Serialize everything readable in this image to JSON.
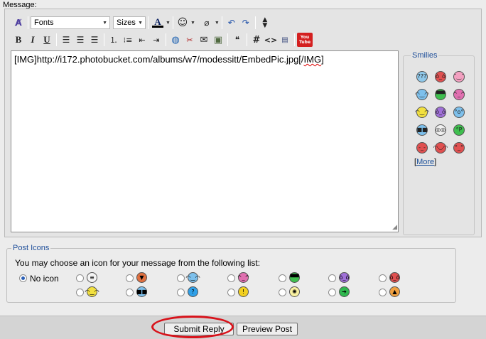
{
  "message_label": "Message:",
  "toolbar": {
    "fonts_select": "Fonts",
    "sizes_select": "Sizes",
    "bold": "B",
    "italic": "I",
    "underline": "U",
    "hash": "#",
    "code": "<>",
    "youtube": "You Tube",
    "icons": [
      "remove-format-icon",
      "font-color-icon",
      "smilie-icon",
      "attach-icon",
      "undo-icon",
      "redo-icon",
      "resize-icon",
      "align-left-icon",
      "align-center-icon",
      "align-right-icon",
      "ordered-list-icon",
      "unordered-list-icon",
      "outdent-icon",
      "indent-icon",
      "link-icon",
      "unlink-icon",
      "email-icon",
      "image-icon",
      "quote-icon",
      "php-icon"
    ]
  },
  "editor": {
    "content_before": "[IMG]http://i172.photobucket.com/albums/w7/modessitt/EmbedPic.jpg[/",
    "content_misspelled": "IMG",
    "content_after": "]"
  },
  "smilies": {
    "legend": "Smilies",
    "more_open": "[",
    "more_link": "More",
    "more_close": "]",
    "items": [
      {
        "glyph": "???",
        "color": "#8fc8ea"
      },
      {
        "glyph": "ò_ó",
        "color": "#e05050"
      },
      {
        "glyph": "˘‿˘",
        "color": "#f2a0c0"
      },
      {
        "glyph": "◠‿◠",
        "color": "#7dc0ec"
      },
      {
        "glyph": "▀▀",
        "color": "#3fbf4f"
      },
      {
        "glyph": "^_^",
        "color": "#e070b0"
      },
      {
        "glyph": "◠‿◠",
        "color": "#f2e040"
      },
      {
        "glyph": "ò_ó",
        "color": "#a070d8"
      },
      {
        "glyph": "°o°",
        "color": "#7dc0ec"
      },
      {
        "glyph": "■■",
        "color": "#7dc0ec"
      },
      {
        "glyph": "◎◎",
        "color": "#f0f0f0"
      },
      {
        "glyph": "°P",
        "color": "#3fbf4f"
      },
      {
        "glyph": "-_-",
        "color": "#e05050"
      },
      {
        "glyph": "◠◡◠",
        "color": "#e05050"
      },
      {
        "glyph": "°_°",
        "color": "#e05050"
      }
    ]
  },
  "post_icons": {
    "legend": "Post Icons",
    "instruction": "You may choose an icon for your message from the following list:",
    "no_icon_label": "No icon",
    "icons": [
      {
        "name": "post-icon-document",
        "glyph": "≡",
        "color": "#f4f4f4"
      },
      {
        "name": "post-icon-thumbs-down",
        "glyph": "▼",
        "color": "#e07040"
      },
      {
        "name": "post-icon-smile-blue",
        "glyph": "◠‿◠",
        "color": "#7dc0ec"
      },
      {
        "name": "post-icon-smile-pink",
        "glyph": "^_^",
        "color": "#e070b0"
      },
      {
        "name": "post-icon-grin-green",
        "glyph": "▀▀",
        "color": "#3fbf4f"
      },
      {
        "name": "post-icon-sad-purple",
        "glyph": "ò_ó",
        "color": "#a070d8"
      },
      {
        "name": "post-icon-angry-red",
        "glyph": "ò_ó",
        "color": "#e05050"
      },
      {
        "name": "post-icon-smile-yellow",
        "glyph": "◠‿◠",
        "color": "#f2e040"
      },
      {
        "name": "post-icon-cool",
        "glyph": "■■",
        "color": "#7dc0ec"
      },
      {
        "name": "post-icon-question",
        "glyph": "?",
        "color": "#2fa0e8"
      },
      {
        "name": "post-icon-warning",
        "glyph": "!",
        "color": "#f2d020"
      },
      {
        "name": "post-icon-lightbulb",
        "glyph": "✺",
        "color": "#f8f0a0"
      },
      {
        "name": "post-icon-arrow",
        "glyph": "➔",
        "color": "#2fb84f"
      },
      {
        "name": "post-icon-thumbs-up",
        "glyph": "▲",
        "color": "#f0a040"
      }
    ]
  },
  "buttons": {
    "submit": "Submit Reply",
    "preview": "Preview Post"
  },
  "colors": {
    "highlight_circle": "#d8131b",
    "legend_text": "#1f4f9a"
  }
}
